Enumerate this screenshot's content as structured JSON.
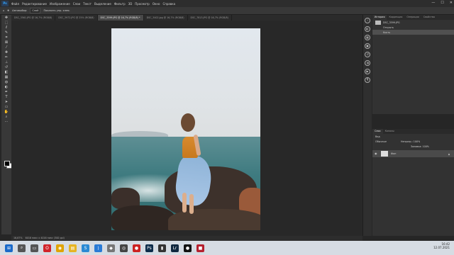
{
  "app": {
    "logo": "Ps"
  },
  "menu": [
    "Файл",
    "Редактирование",
    "Изображение",
    "Слои",
    "Текст",
    "Выделение",
    "Фильтр",
    "3D",
    "Просмотр",
    "Окно",
    "Справка"
  ],
  "window_controls": {
    "minimize": "—",
    "maximize": "☐",
    "close": "✕"
  },
  "options": {
    "tool_label": "Автовыбор:",
    "tool_value": "Слой",
    "transform_label": "Показать упр. элем."
  },
  "tabs": [
    {
      "label": "DSC_3561.JPG @ 16,7% (RGB/8)",
      "active": false
    },
    {
      "label": "DSC_3972.JPG @ 25% (RGB/8)",
      "active": false
    },
    {
      "label": "DSC_3599.JPG @ 16,7% (RGB/8) *",
      "active": true
    },
    {
      "label": "DSC_3402.jpg @ 16,7% (RGB/8)",
      "active": false
    },
    {
      "label": "DSC_7813.JPG @ 16,7% (RGB/8)",
      "active": false
    }
  ],
  "status": {
    "zoom": "16,67%",
    "doc": "6016 пикс x 4016 пикс (300 ppi)"
  },
  "history_panel": {
    "tabs": [
      "История",
      "Коррекция",
      "Операции",
      "Свойства"
    ],
    "file": "DSC_3599.JPG",
    "items": [
      "Открыть",
      "Кисть"
    ]
  },
  "layers_panel": {
    "tabs": [
      "Слои",
      "Каналы"
    ],
    "kind_label": "Вид",
    "mode": "Обычные",
    "opacity_label": "Непрозр.: 100%",
    "fill_label": "Заливка: 100%",
    "layer_name": "Фон"
  },
  "clock": {
    "time": "16:42",
    "date": "12.07.2021"
  },
  "colors": {
    "accent": "#31a8ff",
    "workspace": "#282828",
    "panel": "#323232"
  },
  "taskbar_icons": [
    {
      "name": "windows-start-icon",
      "glyph": "⊞",
      "color": "#1b6ac9"
    },
    {
      "name": "search-icon",
      "glyph": "⌕",
      "color": "#555"
    },
    {
      "name": "task-view-icon",
      "glyph": "▭",
      "color": "#555"
    },
    {
      "name": "opera-icon",
      "glyph": "O",
      "color": "#d1242a"
    },
    {
      "name": "chrome-icon",
      "glyph": "◉",
      "color": "#e0a400"
    },
    {
      "name": "file-explorer-icon",
      "glyph": "▤",
      "color": "#e6b422"
    },
    {
      "name": "skype-icon",
      "glyph": "S",
      "color": "#2a8ad4"
    },
    {
      "name": "vscode-icon",
      "glyph": "⟩",
      "color": "#2a7bd6"
    },
    {
      "name": "app-icon",
      "glyph": "◆",
      "color": "#777"
    },
    {
      "name": "media-icon",
      "glyph": "◎",
      "color": "#444"
    },
    {
      "name": "red-app-icon",
      "glyph": "●",
      "color": "#c22"
    },
    {
      "name": "photoshop-icon",
      "glyph": "Ps",
      "color": "#0d2c4a"
    },
    {
      "name": "app2-icon",
      "glyph": "▮",
      "color": "#333"
    },
    {
      "name": "lightroom-icon",
      "glyph": "Lr",
      "color": "#10283f"
    },
    {
      "name": "bandicam-icon",
      "glyph": "●",
      "color": "#111"
    },
    {
      "name": "app3-icon",
      "glyph": "■",
      "color": "#b5202e"
    }
  ]
}
